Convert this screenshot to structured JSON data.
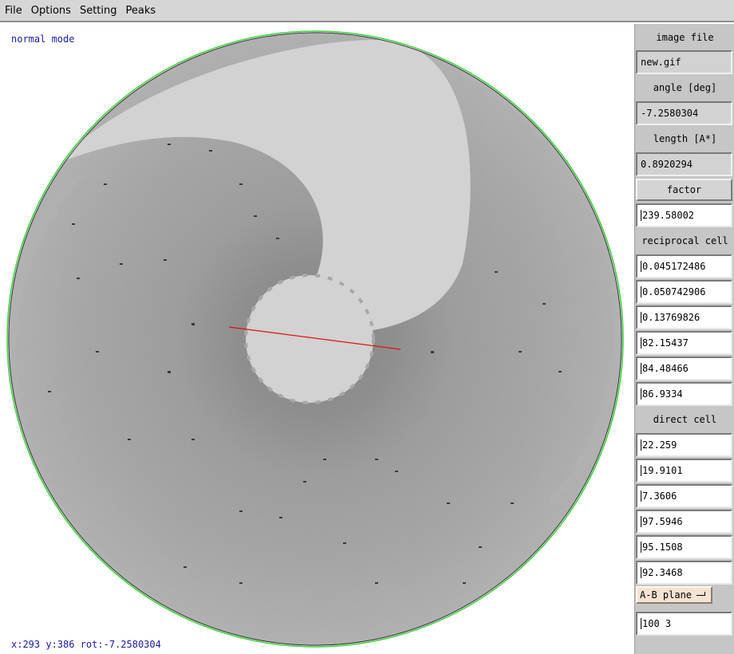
{
  "menubar": {
    "items": [
      {
        "label": "File"
      },
      {
        "label": "Options"
      },
      {
        "label": "Setting"
      },
      {
        "label": "Peaks"
      }
    ]
  },
  "canvas": {
    "mode": "normal mode",
    "status": "x:293 y:386  rot:-7.2580304",
    "colors": {
      "detector_ring": "#3cd23c",
      "measurement_line": "#e01010",
      "shadow": "#d2d2d2",
      "background_grey": "#9c9c9c"
    }
  },
  "panel": {
    "image_file_label": "image file",
    "image_file_value": "new.gif",
    "angle_label": "angle [deg]",
    "angle_value": "-7.2580304",
    "length_label": "length [A*]",
    "length_value": "0.8920294",
    "factor_label": "factor",
    "factor_value": "239.58002",
    "reciprocal_label": "reciprocal cell",
    "reciprocal_values": [
      "0.045172486",
      "0.050742906",
      "0.13769826",
      "82.15437",
      "84.48466",
      "86.9334"
    ],
    "direct_label": "direct cell",
    "direct_values": [
      "22.259",
      "19.9101",
      "7.3606",
      "97.5946",
      "95.1508",
      "92.3468"
    ],
    "plane_selected": "A-B  plane",
    "bottom_value": "100 3"
  }
}
